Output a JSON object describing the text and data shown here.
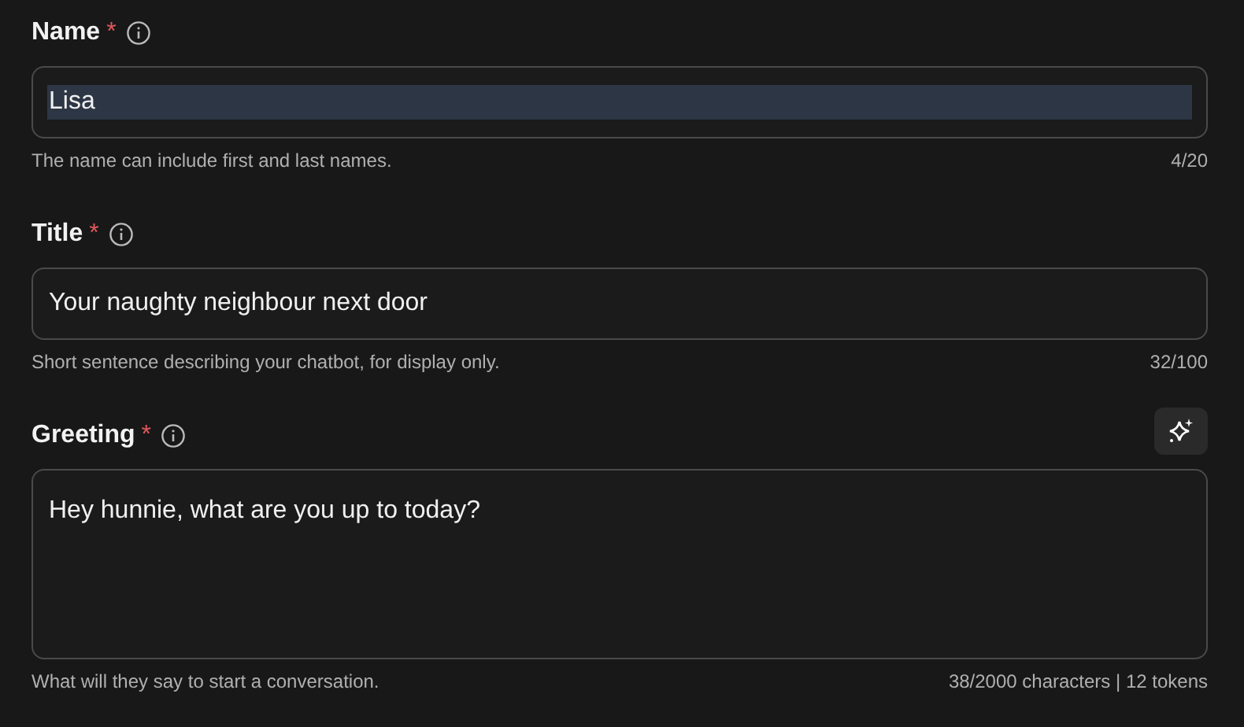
{
  "fields": [
    {
      "kind": "input",
      "label": "Name",
      "required_mark": "*",
      "value": "Lisa",
      "selected": true,
      "hint": "The name can include first and last names.",
      "counter": "4/20"
    },
    {
      "kind": "input",
      "label": "Title",
      "required_mark": "*",
      "value": "Your naughty neighbour next door",
      "selected": false,
      "hint": "Short sentence describing your chatbot, for display only.",
      "counter": "32/100"
    },
    {
      "kind": "textarea",
      "label": "Greeting",
      "required_mark": "*",
      "value": "Hey hunnie, what are you up to today?",
      "selected": false,
      "hint": "What will they say to start a conversation.",
      "counter": "38/2000 characters | 12 tokens",
      "assist_button": true
    }
  ]
}
